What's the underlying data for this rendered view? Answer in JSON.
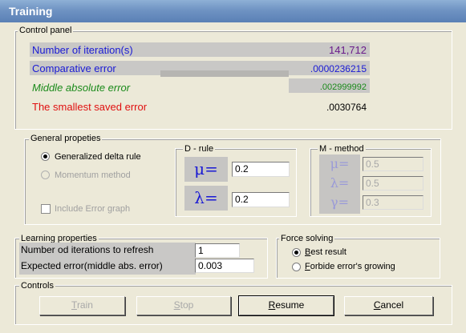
{
  "window": {
    "title": "Training"
  },
  "control_panel": {
    "label": "Control panel",
    "rows": [
      {
        "label": "Number of iteration(s)",
        "value": "141,712",
        "label_color": "#1a1ad4",
        "value_color": "#6a1b8a"
      },
      {
        "label": "Comparative error",
        "value": ".0000236215",
        "label_color": "#1a1ad4",
        "value_color": "#1a1ad4"
      },
      {
        "label": "Middle absolute error",
        "value": ".002999992",
        "label_color": "#1a8a1a",
        "value_color": "#1a8a1a"
      },
      {
        "label": "The smallest saved error",
        "value": ".0030764",
        "label_color": "#e01010",
        "value_color": "#000000"
      }
    ]
  },
  "general": {
    "label": "General propeties",
    "generalized_delta_rule": "Generalized delta rule",
    "momentum_method": "Momentum method",
    "include_error_graph": "Include Error graph",
    "d_rule": {
      "label": "D - rule",
      "mu_symbol": "μ=",
      "mu_value": "0.2",
      "lambda_symbol": "λ=",
      "lambda_value": "0.2"
    },
    "m_method": {
      "label": "M - method",
      "mu_symbol": "μ=",
      "mu_value": "0.5",
      "lambda_symbol": "λ=",
      "lambda_value": "0.5",
      "gamma_symbol": "γ=",
      "gamma_value": "0.3"
    }
  },
  "learning": {
    "label": "Learning properties",
    "refresh_label": "Number od iterations to refresh",
    "refresh_value": "1",
    "expected_label": "Expected error(middle abs. error)",
    "expected_value": "0.003"
  },
  "force": {
    "label": "Force solving",
    "best_mnemonic": "B",
    "best_rest": "est result",
    "forbide_mnemonic": "F",
    "forbide_rest": "orbide error's growing"
  },
  "controls": {
    "label": "Controls",
    "train_mnemonic": "T",
    "train_rest": "rain",
    "stop_mnemonic": "S",
    "stop_rest": "top",
    "resume_mnemonic": "R",
    "resume_rest": "esume",
    "cancel_mnemonic": "C",
    "cancel_rest": "ancel"
  }
}
